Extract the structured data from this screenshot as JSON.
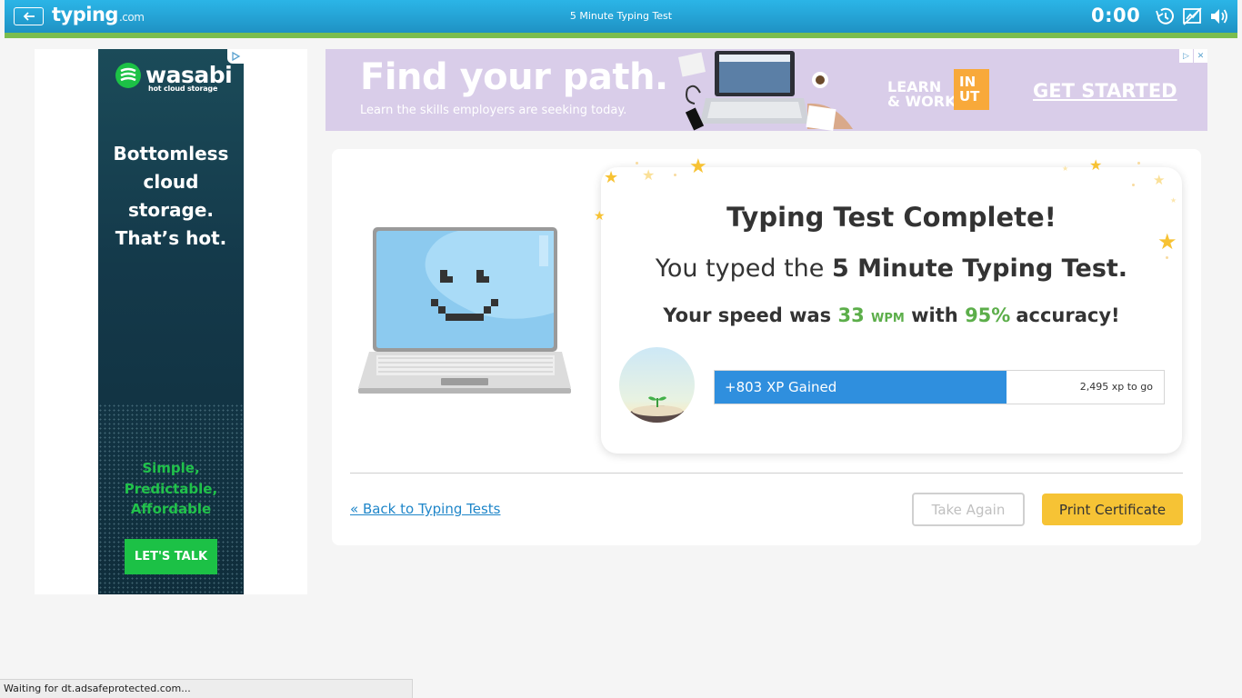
{
  "topbar": {
    "back_icon": "arrow-left-icon",
    "logo_main": "typing",
    "logo_suffix": ".com",
    "title": "5 Minute Typing Test",
    "timer": "0:00",
    "icons": [
      "history-icon",
      "speed-chart-icon",
      "volume-icon"
    ],
    "colors": {
      "bar": "#1f92c4",
      "accent_line": "#7bbd4e"
    }
  },
  "left_ad": {
    "brand": "wasabi",
    "brand_sub": "hot cloud storage",
    "headline_lines": [
      "Bottomless",
      "cloud",
      "storage.",
      "That’s hot."
    ],
    "tagline_lines": [
      "Simple,",
      "Predictable,",
      "Affordable"
    ],
    "cta": "LET'S TALK",
    "ad_choices_icon": "ad-choices-icon"
  },
  "top_ad": {
    "headline": "Find your path.",
    "subline": "Learn the skills employers are seeking today.",
    "learn_work_lines": [
      "LEARN",
      "& WORK"
    ],
    "in_out_lines": [
      "IN",
      "UT"
    ],
    "cta": "GET STARTED"
  },
  "result": {
    "title": "Typing Test Complete!",
    "typed_prefix": "You typed the",
    "test_name": "5 Minute Typing Test.",
    "speed_prefix": "Your speed was",
    "speed_value": "33",
    "speed_unit": "WPM",
    "speed_mid": "with",
    "accuracy": "95%",
    "speed_suffix": "accuracy!",
    "xp_gained": "+803 XP Gained",
    "xp_to_go": "2,495 xp to go",
    "xp_progress": 0.65,
    "colors": {
      "green": "#5cae4a",
      "xp_blue": "#2f8fde"
    }
  },
  "actions": {
    "back_link": "« Back to Typing Tests",
    "take_again": "Take Again",
    "print_certificate": "Print Certificate",
    "print_color": "#f6c335"
  },
  "status_bar": {
    "text": "Waiting for dt.adsafeprotected.com..."
  }
}
